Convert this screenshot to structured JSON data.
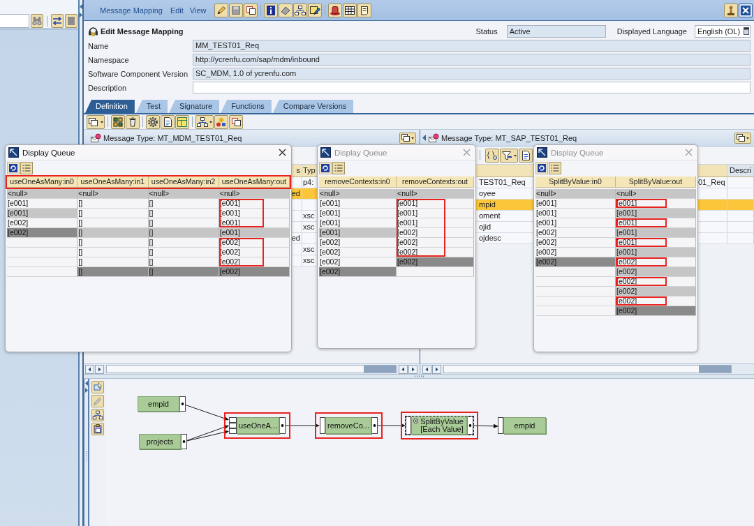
{
  "menu": [
    "Message Mapping",
    "Edit",
    "View"
  ],
  "editor": {
    "title": "Edit Message Mapping",
    "status_label": "Status",
    "status": "Active",
    "language_label": "Displayed Language",
    "language": "English (OL)",
    "fields": [
      {
        "label": "Name",
        "value": "MM_TEST01_Req",
        "editable": false
      },
      {
        "label": "Namespace",
        "value": "http://ycrenfu.com/sap/mdm/inbound",
        "editable": false
      },
      {
        "label": "Software Component Version",
        "value": "SC_MDM, 1.0 of ycrenfu.com",
        "editable": false
      },
      {
        "label": "Description",
        "editable": true
      }
    ]
  },
  "tabs": [
    {
      "label": "Definition",
      "selected": true
    },
    {
      "label": "Test",
      "selected": false
    },
    {
      "label": "Signature",
      "selected": false
    },
    {
      "label": "Functions",
      "selected": false
    },
    {
      "label": "Compare Versions",
      "selected": false
    }
  ],
  "source_structure": {
    "title": "Message Type: MT_MDM_TEST01_Req",
    "headers": {
      "column_1": "s",
      "column_2": "Typ"
    },
    "rows": [
      {
        "column_2": "p4:",
        "selected": false
      },
      {
        "column_1": "ed",
        "selected": true
      },
      {
        "selected": false
      },
      {
        "column_2": "xsc",
        "selected": false
      },
      {
        "column_2": "xsc",
        "selected": false
      },
      {
        "column_1": "ed",
        "selected": false
      },
      {
        "column_2": "xsc",
        "selected": false
      },
      {
        "column_2": "xsc",
        "selected": false
      }
    ]
  },
  "target_structure": {
    "title": "Message Type: MT_SAP_TEST01_Req",
    "headers": {
      "column_3": "Descri"
    },
    "rows": [
      {
        "column_1": "TEST01_Req",
        "column_2": "01_Req",
        "selected": false
      },
      {
        "column_1": "oyee",
        "selected": false
      },
      {
        "column_1": "mpid",
        "selected": true
      },
      {
        "column_1": "oment",
        "selected": false
      },
      {
        "column_1": "ojid",
        "selected": false
      },
      {
        "column_1": "ojdesc",
        "selected": false
      }
    ]
  },
  "queues": [
    {
      "title": "Display Queue",
      "active": true,
      "header_highlighted": true,
      "columns": [
        {
          "header": "useOneAsMany:in0",
          "cells": [
            {
              "text": "<null>",
              "kind": "context",
              "highlighted": false
            },
            {
              "text": "[e001]",
              "kind": "plain",
              "highlighted": false
            },
            {
              "text": "[e001]",
              "kind": "context",
              "highlighted": false
            },
            {
              "text": "[e002]",
              "kind": "plain",
              "highlighted": false
            },
            {
              "text": "[e002]",
              "kind": "last",
              "highlighted": false
            },
            {
              "kind": "plain",
              "highlighted": false
            },
            {
              "kind": "plain",
              "highlighted": false
            },
            {
              "kind": "plain",
              "highlighted": false
            },
            {
              "kind": "plain",
              "highlighted": false
            }
          ]
        },
        {
          "header": "useOneAsMany:in1",
          "cells": [
            {
              "text": "<null>",
              "kind": "context",
              "highlighted": false
            },
            {
              "text": "[]",
              "kind": "plain",
              "highlighted": false
            },
            {
              "text": "[]",
              "kind": "plain",
              "highlighted": false
            },
            {
              "text": "[]",
              "kind": "plain",
              "highlighted": false
            },
            {
              "text": "[]",
              "kind": "context",
              "highlighted": false
            },
            {
              "text": "[]",
              "kind": "plain",
              "highlighted": false
            },
            {
              "text": "[]",
              "kind": "plain",
              "highlighted": false
            },
            {
              "text": "[]",
              "kind": "plain",
              "highlighted": false
            },
            {
              "text": "[]",
              "kind": "last",
              "highlighted": false
            }
          ]
        },
        {
          "header": "useOneAsMany:in2",
          "cells": [
            {
              "text": "<null>",
              "kind": "context",
              "highlighted": false
            },
            {
              "text": "[]",
              "kind": "plain",
              "highlighted": false
            },
            {
              "text": "[]",
              "kind": "plain",
              "highlighted": false
            },
            {
              "text": "[]",
              "kind": "plain",
              "highlighted": false
            },
            {
              "text": "[]",
              "kind": "context",
              "highlighted": false
            },
            {
              "text": "[]",
              "kind": "plain",
              "highlighted": false
            },
            {
              "text": "[]",
              "kind": "plain",
              "highlighted": false
            },
            {
              "text": "[]",
              "kind": "plain",
              "highlighted": false
            },
            {
              "text": "[]",
              "kind": "last",
              "highlighted": false
            }
          ]
        },
        {
          "header": "useOneAsMany:out",
          "cells": [
            {
              "text": "<null>",
              "kind": "context",
              "highlighted": false
            },
            {
              "text": "[e001]",
              "kind": "plain",
              "highlighted": true
            },
            {
              "text": "[e001]",
              "kind": "plain",
              "highlighted": true
            },
            {
              "text": "[e001]",
              "kind": "plain",
              "highlighted": true
            },
            {
              "text": "[e001]",
              "kind": "context",
              "highlighted": false
            },
            {
              "text": "[e002]",
              "kind": "plain",
              "highlighted": true
            },
            {
              "text": "[e002]",
              "kind": "plain",
              "highlighted": true
            },
            {
              "text": "[e002]",
              "kind": "plain",
              "highlighted": true
            },
            {
              "text": "[e002]",
              "kind": "last",
              "highlighted": false
            }
          ]
        }
      ]
    },
    {
      "title": "Display Queue",
      "active": false,
      "header_highlighted": false,
      "columns": [
        {
          "header": "removeContexts:in0",
          "cells": [
            {
              "text": "<null>",
              "kind": "context",
              "highlighted": false
            },
            {
              "text": "[e001]",
              "kind": "plain",
              "highlighted": false
            },
            {
              "text": "[e001]",
              "kind": "plain",
              "highlighted": false
            },
            {
              "text": "[e001]",
              "kind": "plain",
              "highlighted": false
            },
            {
              "text": "[e001]",
              "kind": "context",
              "highlighted": false
            },
            {
              "text": "[e002]",
              "kind": "plain",
              "highlighted": false
            },
            {
              "text": "[e002]",
              "kind": "plain",
              "highlighted": false
            },
            {
              "text": "[e002]",
              "kind": "plain",
              "highlighted": false
            },
            {
              "text": "[e002]",
              "kind": "last",
              "highlighted": false
            }
          ]
        },
        {
          "header": "removeContexts:out",
          "cells": [
            {
              "text": "<null>",
              "kind": "context",
              "highlighted": false
            },
            {
              "text": "[e001]",
              "kind": "plain",
              "highlighted": true
            },
            {
              "text": "[e001]",
              "kind": "plain",
              "highlighted": true
            },
            {
              "text": "[e001]",
              "kind": "plain",
              "highlighted": true
            },
            {
              "text": "[e002]",
              "kind": "plain",
              "highlighted": true
            },
            {
              "text": "[e002]",
              "kind": "plain",
              "highlighted": true
            },
            {
              "text": "[e002]",
              "kind": "plain",
              "highlighted": true
            },
            {
              "text": "[e002]",
              "kind": "last",
              "highlighted": false
            },
            {
              "kind": "plain",
              "highlighted": false
            }
          ]
        }
      ]
    },
    {
      "title": "Display Queue",
      "active": false,
      "header_highlighted": false,
      "columns": [
        {
          "header": "SplitByValue:in0",
          "cells": [
            {
              "text": "<null>",
              "kind": "context",
              "highlighted": false
            },
            {
              "text": "[e001]",
              "kind": "plain",
              "highlighted": false
            },
            {
              "text": "[e001]",
              "kind": "plain",
              "highlighted": false
            },
            {
              "text": "[e001]",
              "kind": "plain",
              "highlighted": false
            },
            {
              "text": "[e002]",
              "kind": "plain",
              "highlighted": false
            },
            {
              "text": "[e002]",
              "kind": "plain",
              "highlighted": false
            },
            {
              "text": "[e002]",
              "kind": "plain",
              "highlighted": false
            },
            {
              "text": "[e002]",
              "kind": "last",
              "highlighted": false
            },
            {
              "kind": "plain",
              "highlighted": false
            },
            {
              "kind": "plain",
              "highlighted": false
            },
            {
              "kind": "plain",
              "highlighted": false
            },
            {
              "kind": "plain",
              "highlighted": false
            },
            {
              "kind": "plain",
              "highlighted": false
            }
          ]
        },
        {
          "header": "SplitByValue:out",
          "cells": [
            {
              "text": "<null>",
              "kind": "context",
              "highlighted": false
            },
            {
              "text": "[e001]",
              "kind": "plain",
              "highlighted": true
            },
            {
              "text": "[e001]",
              "kind": "context",
              "highlighted": false
            },
            {
              "text": "[e001]",
              "kind": "plain",
              "highlighted": true
            },
            {
              "text": "[e001]",
              "kind": "context",
              "highlighted": false
            },
            {
              "text": "[e001]",
              "kind": "plain",
              "highlighted": true
            },
            {
              "text": "[e001]",
              "kind": "context",
              "highlighted": false
            },
            {
              "text": "[e002]",
              "kind": "plain",
              "highlighted": true
            },
            {
              "text": "[e002]",
              "kind": "context",
              "highlighted": false
            },
            {
              "text": "[e002]",
              "kind": "plain",
              "highlighted": true
            },
            {
              "text": "[e002]",
              "kind": "context",
              "highlighted": false
            },
            {
              "text": "[e002]",
              "kind": "plain",
              "highlighted": true
            },
            {
              "text": "[e002]",
              "kind": "last",
              "highlighted": false
            }
          ]
        }
      ]
    }
  ],
  "mapping": {
    "nodes": [
      {
        "kind": "source",
        "label": "empid"
      },
      {
        "kind": "source",
        "label": "projects"
      },
      {
        "kind": "function",
        "label": "useOneA...",
        "highlighted": true,
        "selected": false
      },
      {
        "kind": "function",
        "label": "removeCo...",
        "highlighted": true,
        "selected": false
      },
      {
        "kind": "function",
        "label": "SplitByValue",
        "sublabel": "[Each Value]",
        "highlighted": true,
        "selected": true
      },
      {
        "kind": "target",
        "label": "empid"
      }
    ]
  }
}
